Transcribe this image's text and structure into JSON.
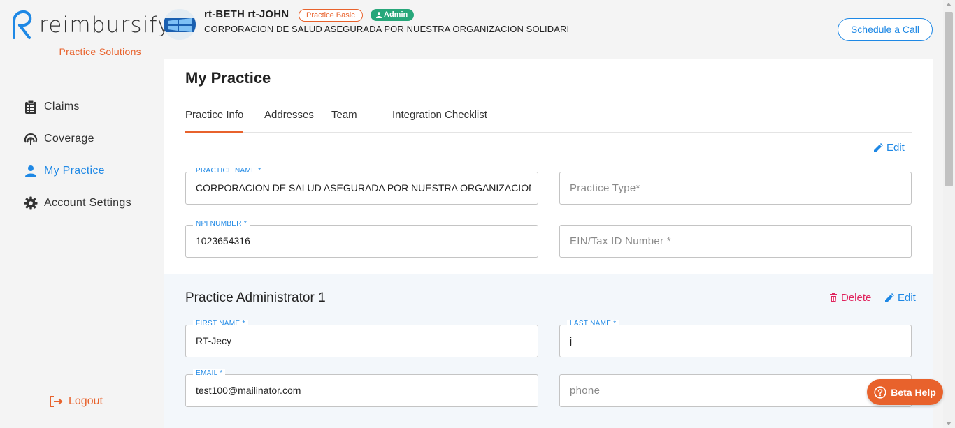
{
  "brand": {
    "name": "reimbursify",
    "tagline": "Practice Solutions",
    "accent": "#e8622c",
    "primary": "#1e88e5"
  },
  "sidebar": {
    "items": [
      {
        "label": "Claims",
        "icon": "clipboard-icon"
      },
      {
        "label": "Coverage",
        "icon": "coverage-icon"
      },
      {
        "label": "My Practice",
        "icon": "person-icon",
        "active": true
      },
      {
        "label": "Account Settings",
        "icon": "gear-icon"
      }
    ],
    "logout_label": "Logout"
  },
  "header": {
    "user_name": "rt-BETH rt-JOHN",
    "plan_badge": "Practice Basic",
    "role_badge": "Admin",
    "org_name": "CORPORACION DE SALUD ASEGURADA POR NUESTRA ORGANIZACION SOLIDARI",
    "schedule_label": "Schedule a Call"
  },
  "page": {
    "title": "My Practice",
    "tabs": [
      {
        "label": "Practice Info",
        "active": true
      },
      {
        "label": "Addresses"
      },
      {
        "label": "Team"
      },
      {
        "label": "Integration Checklist"
      }
    ],
    "edit_label": "Edit",
    "practice": {
      "name_label": "PRACTICE NAME *",
      "name_value": "CORPORACION DE SALUD ASEGURADA POR NUESTRA ORGANIZACION SOLIDARIA",
      "type_placeholder": "Practice Type*",
      "npi_label": "NPI NUMBER *",
      "npi_value": "1023654316",
      "ein_placeholder": "EIN/Tax ID Number *"
    },
    "admin": {
      "title": "Practice Administrator 1",
      "delete_label": "Delete",
      "edit_label": "Edit",
      "first_name_label": "FIRST NAME *",
      "first_name_value": "RT-Jecy",
      "last_name_label": "LAST NAME *",
      "last_name_value": "j",
      "email_label": "EMAIL *",
      "email_value": "test100@mailinator.com",
      "phone_placeholder": "phone"
    }
  },
  "beta_help_label": "Beta Help"
}
